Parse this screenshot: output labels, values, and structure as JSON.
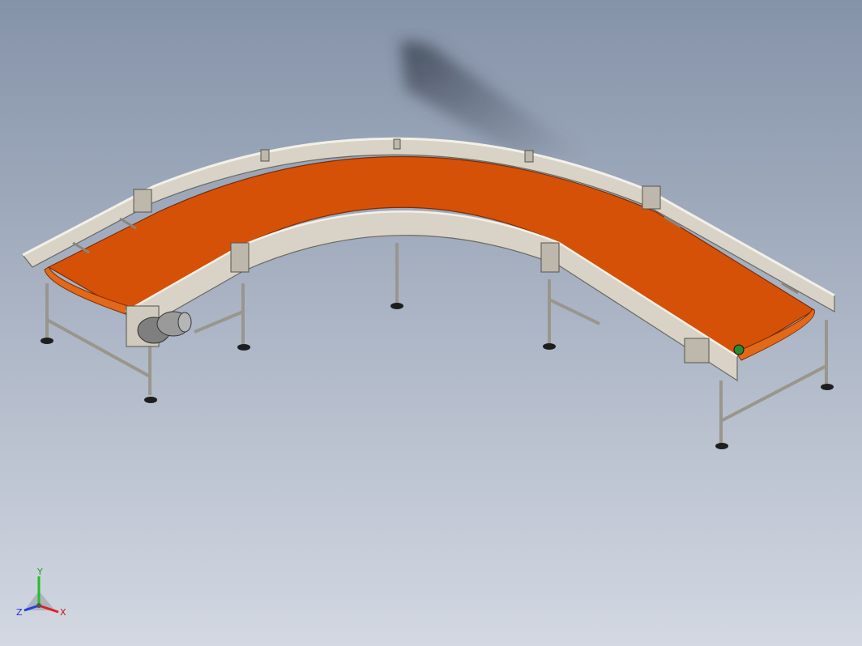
{
  "viewport": {
    "background_top": "#8593a9",
    "background_bottom": "#d3d8e2"
  },
  "model": {
    "name": "curved-belt-conveyor",
    "belt_color": "#d65108",
    "frame_color": "#d8d3c6",
    "motor_color": "#7f7f7f"
  },
  "triad": {
    "x_label": "X",
    "y_label": "Y",
    "z_label": "Z",
    "x_color": "#e02020",
    "y_color": "#20c020",
    "z_color": "#2040e0"
  }
}
